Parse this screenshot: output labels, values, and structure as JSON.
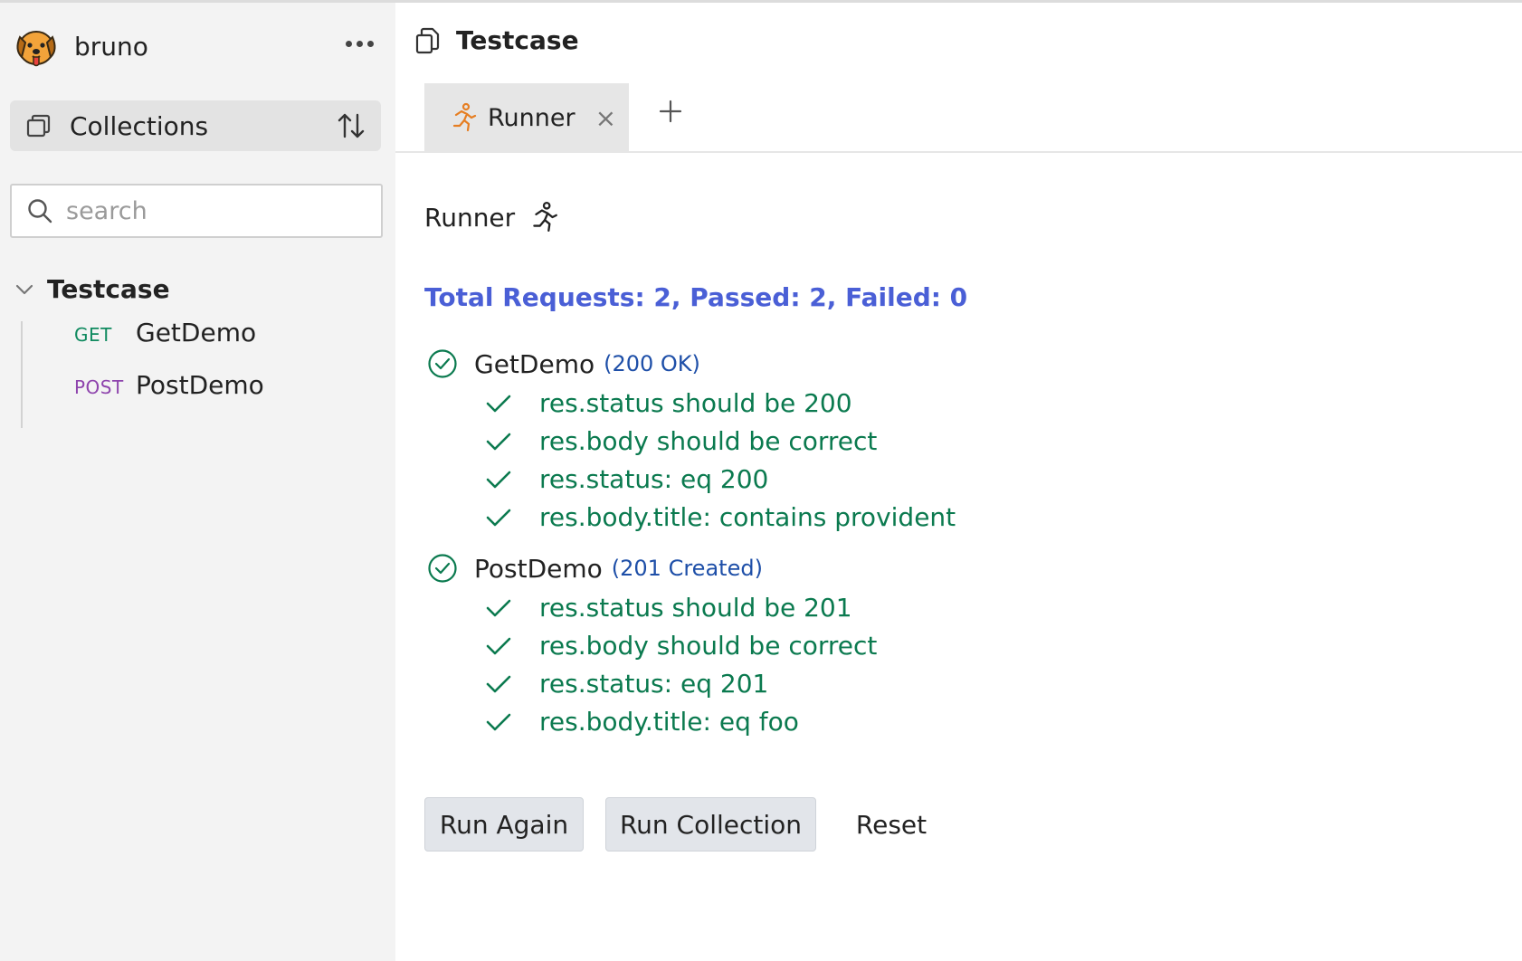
{
  "app": {
    "name": "bruno",
    "logo_icon": "dog-logo-icon"
  },
  "sidebar": {
    "collections_label": "Collections",
    "search_placeholder": "search",
    "collection": {
      "name": "Testcase",
      "requests": [
        {
          "method": "GET",
          "name": "GetDemo"
        },
        {
          "method": "POST",
          "name": "PostDemo"
        }
      ]
    }
  },
  "main": {
    "title": "Testcase",
    "tabs": [
      {
        "label": "Runner",
        "close": "×"
      }
    ],
    "runner": {
      "heading": "Runner",
      "summary": "Total Requests: 2, Passed: 2, Failed: 0",
      "results": [
        {
          "name": "GetDemo",
          "status": "(200 OK)",
          "assertions": [
            "res.status should be 200",
            "res.body should be correct",
            "res.status: eq 200",
            "res.body.title: contains provident"
          ]
        },
        {
          "name": "PostDemo",
          "status": "(201 Created)",
          "assertions": [
            "res.status should be 201",
            "res.body should be correct",
            "res.status: eq 201",
            "res.body.title: eq foo"
          ]
        }
      ],
      "buttons": {
        "run_again": "Run Again",
        "run_collection": "Run Collection",
        "reset": "Reset"
      }
    }
  },
  "colors": {
    "sidebar_bg": "#f3f3f3",
    "summary": "#4a5fd6",
    "pass_green": "#0b7a4f",
    "status_blue": "#1e4fa8",
    "get_method": "#0f8a5f",
    "post_method": "#8e44ad",
    "runner_tab_icon": "#e67e22"
  }
}
